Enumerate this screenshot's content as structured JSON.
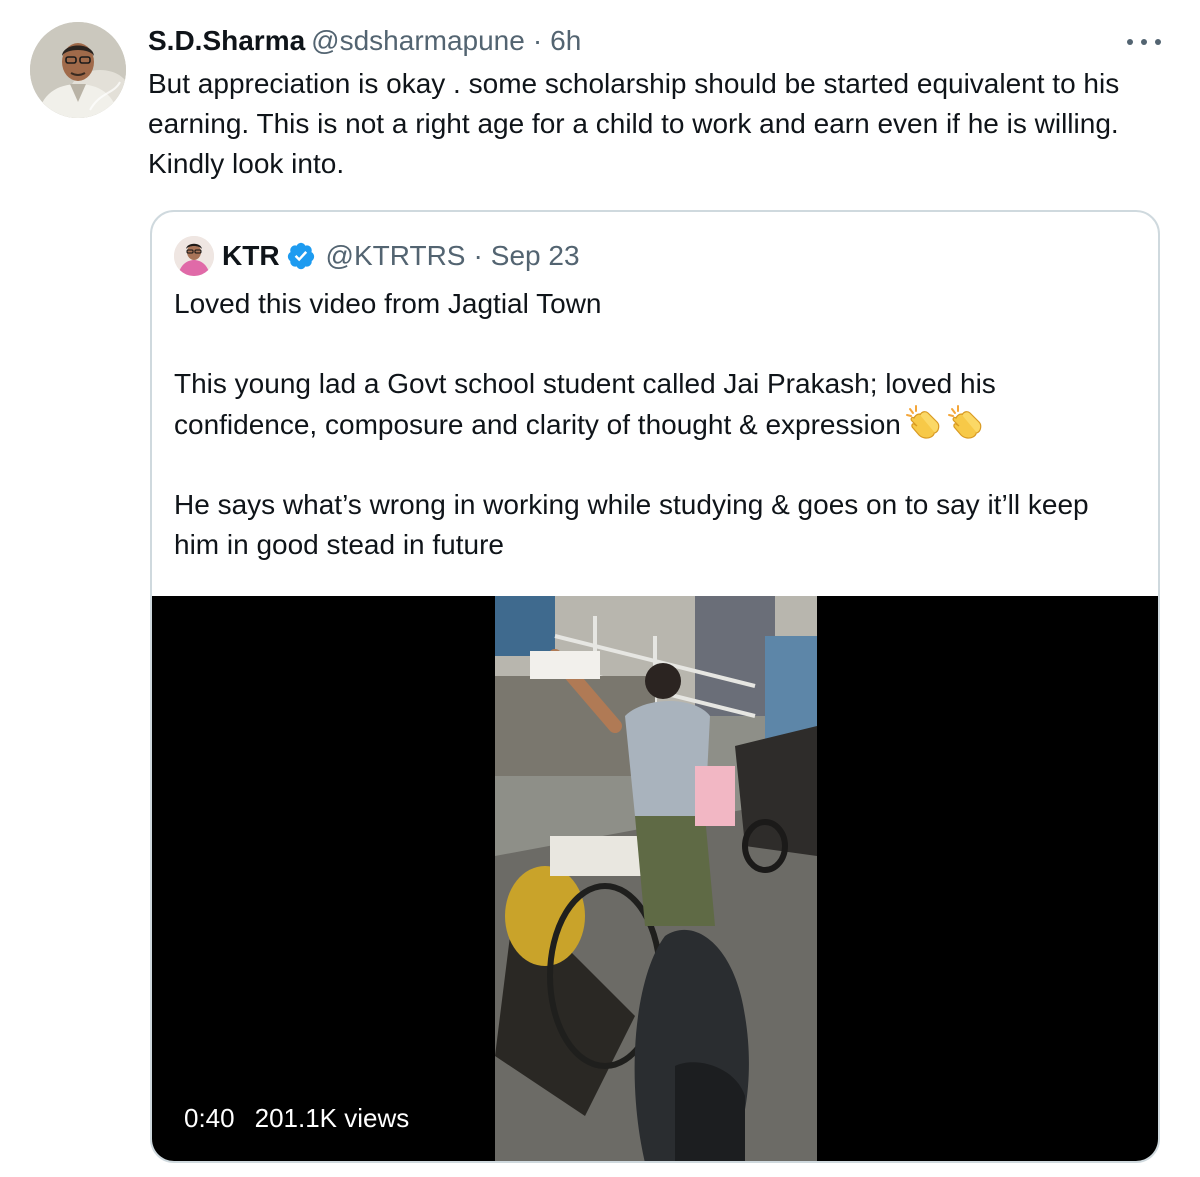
{
  "tweet": {
    "author_name": "S.D.Sharma",
    "handle": "@sdsharmapune",
    "separator": "·",
    "time": "6h",
    "text": "But appreciation is okay . some scholarship should be started equivalent to his earning. This is not a right age for a child to work and earn even if he is willing. Kindly look into.",
    "avatar_icon": "profile-photo",
    "more_icon": "ellipsis-icon"
  },
  "quoted_tweet": {
    "author_name": "KTR",
    "verified_icon": "verified-badge-icon",
    "verified_color": "#1d9bf0",
    "handle": "@KTRTRS",
    "separator": "·",
    "time": "Sep 23",
    "paragraphs": [
      "Loved this video from Jagtial Town",
      "This young lad a Govt school student called Jai Prakash; loved his confidence, composure and clarity of thought & expression",
      "He says what’s wrong in working while studying & goes on to say it’ll keep him in good stead in future"
    ],
    "emoji": "clapping-hands-icon",
    "video": {
      "duration": "0:40",
      "views": "201.1K views"
    }
  },
  "colors": {
    "text_primary": "#0f1419",
    "text_secondary": "#536471",
    "border": "#cfd9de",
    "video_background": "#000000"
  }
}
